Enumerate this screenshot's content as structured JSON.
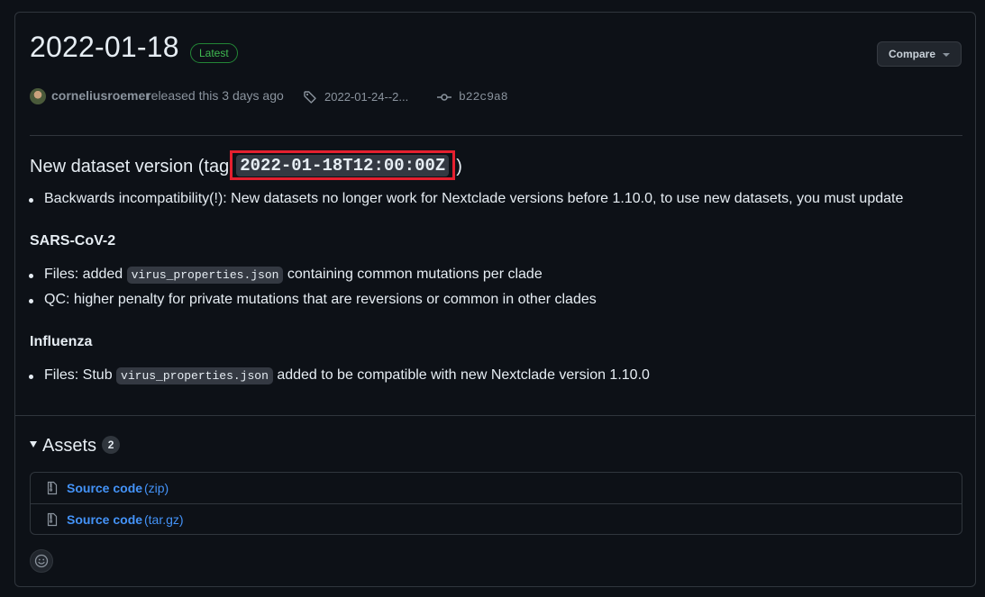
{
  "release": {
    "title": "2022-01-18",
    "latest_badge": "Latest",
    "compare_label": "Compare",
    "author": "corneliusroemer",
    "released_text": "released this 3 days ago",
    "tag": "2022-01-24--2...",
    "commit": "b22c9a8"
  },
  "body": {
    "heading_prefix": "New dataset version (tag",
    "heading_tag": "2022-01-18T12:00:00Z",
    "heading_suffix": ")",
    "intro_item": "Backwards incompatibility(!): New datasets no longer work for Nextclade versions before 1.10.0, to use new datasets, you must update",
    "sars_heading": "SARS-CoV-2",
    "sars_item1_prefix": "Files: added",
    "sars_item1_code": "virus_properties.json",
    "sars_item1_suffix": "containing common mutations per clade",
    "sars_item2": "QC: higher penalty for private mutations that are reversions or common in other clades",
    "flu_heading": "Influenza",
    "flu_item_prefix": "Files: Stub",
    "flu_item_code": "virus_properties.json",
    "flu_item_suffix": "added to be compatible with new Nextclade version 1.10.0"
  },
  "assets": {
    "label": "Assets",
    "count": "2",
    "items": [
      {
        "name": "Source code",
        "ext": "(zip)"
      },
      {
        "name": "Source code",
        "ext": "(tar.gz)"
      }
    ]
  },
  "icons": {
    "tag": "tag-icon",
    "commit": "git-commit-icon",
    "zip": "file-zip-icon",
    "emoji": "smiley-icon"
  },
  "colors": {
    "background": "#0d1117",
    "link": "#4493f8",
    "latest_green": "#3fb950",
    "highlight_red": "#e5202f"
  }
}
